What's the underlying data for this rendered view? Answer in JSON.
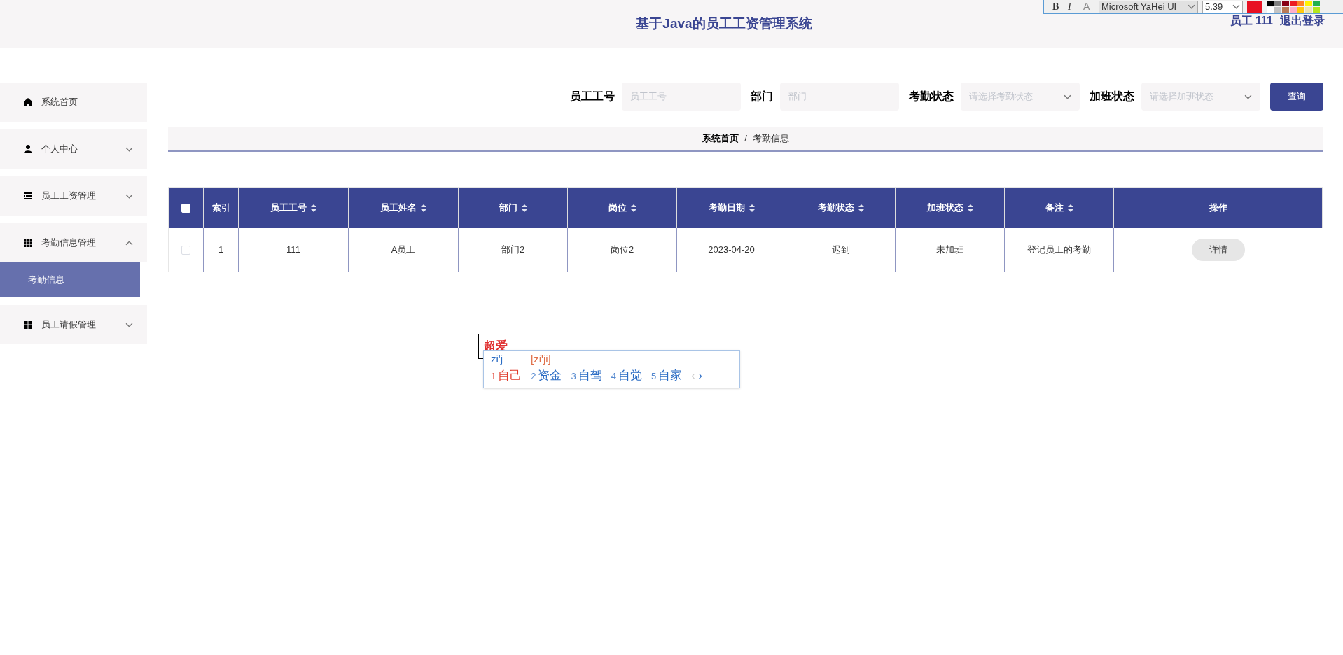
{
  "header": {
    "title": "基于Java的员工工资管理系统",
    "user": "员工 111",
    "logout": "退出登录"
  },
  "format_toolbar": {
    "bold": "B",
    "italic": "I",
    "outline": "A",
    "font": "Microsoft YaHei UI",
    "size": "5.39",
    "current": {
      "color": "#e81123"
    },
    "swatches": [
      {
        "color": "#000000"
      },
      {
        "color": "#7f7f7f"
      },
      {
        "color": "#880015"
      },
      {
        "color": "#ed1c24"
      },
      {
        "color": "#ff7f27"
      },
      {
        "color": "#fff200"
      },
      {
        "color": "#22b14c"
      },
      {
        "color": "#ffffff"
      },
      {
        "color": "#c3c3c3"
      },
      {
        "color": "#b97a57"
      },
      {
        "color": "#ffaec9"
      },
      {
        "color": "#ffc90e"
      },
      {
        "color": "#efe4b0"
      },
      {
        "color": "#b5e61d"
      }
    ]
  },
  "sidebar": {
    "items": [
      {
        "label": "系统首页",
        "kind": "home"
      },
      {
        "label": "个人中心",
        "kind": "person",
        "expanded": false
      },
      {
        "label": "员工工资管理",
        "kind": "list",
        "expanded": false
      },
      {
        "label": "考勤信息管理",
        "kind": "grid9",
        "expanded": true,
        "children": [
          {
            "label": "考勤信息",
            "selected": true
          }
        ]
      },
      {
        "label": "员工请假管理",
        "kind": "grid4",
        "expanded": false
      }
    ]
  },
  "search": {
    "fields": [
      {
        "label": "员工工号",
        "placeholder": "员工工号",
        "kind": "input"
      },
      {
        "label": "部门",
        "placeholder": "部门",
        "kind": "input"
      },
      {
        "label": "考勤状态",
        "placeholder": "请选择考勤状态",
        "kind": "select"
      },
      {
        "label": "加班状态",
        "placeholder": "请选择加班状态",
        "kind": "select"
      }
    ],
    "button": "查询"
  },
  "breadcrumb": {
    "items": [
      "系统首页",
      "考勤信息"
    ],
    "separator": "/"
  },
  "table": {
    "all_checked": false,
    "columns": [
      {
        "label": "索引",
        "sortable": false
      },
      {
        "label": "员工工号",
        "sortable": true
      },
      {
        "label": "员工姓名",
        "sortable": true
      },
      {
        "label": "部门",
        "sortable": true
      },
      {
        "label": "岗位",
        "sortable": true
      },
      {
        "label": "考勤日期",
        "sortable": true
      },
      {
        "label": "考勤状态",
        "sortable": true
      },
      {
        "label": "加班状态",
        "sortable": true
      },
      {
        "label": "备注",
        "sortable": true
      },
      {
        "label": "操作",
        "sortable": false
      }
    ],
    "rows": [
      {
        "checked": false,
        "cells": [
          "1",
          "111",
          "A员工",
          "部门2",
          "岗位2",
          "2023-04-20",
          "迟到",
          "未加班",
          "登记员工的考勤"
        ],
        "action": "详情"
      }
    ]
  },
  "text_box": {
    "text": "超爱"
  },
  "ime": {
    "input": "zi'j",
    "pinyin": "[zi'ji]",
    "candidates": [
      {
        "number": "1",
        "text": "自己",
        "selected": true
      },
      {
        "number": "2",
        "text": "资金",
        "selected": false
      },
      {
        "number": "3",
        "text": "自驾",
        "selected": false
      },
      {
        "number": "4",
        "text": "自觉",
        "selected": false
      },
      {
        "number": "5",
        "text": "自家",
        "selected": false
      }
    ],
    "prev": "‹",
    "next": "›"
  }
}
